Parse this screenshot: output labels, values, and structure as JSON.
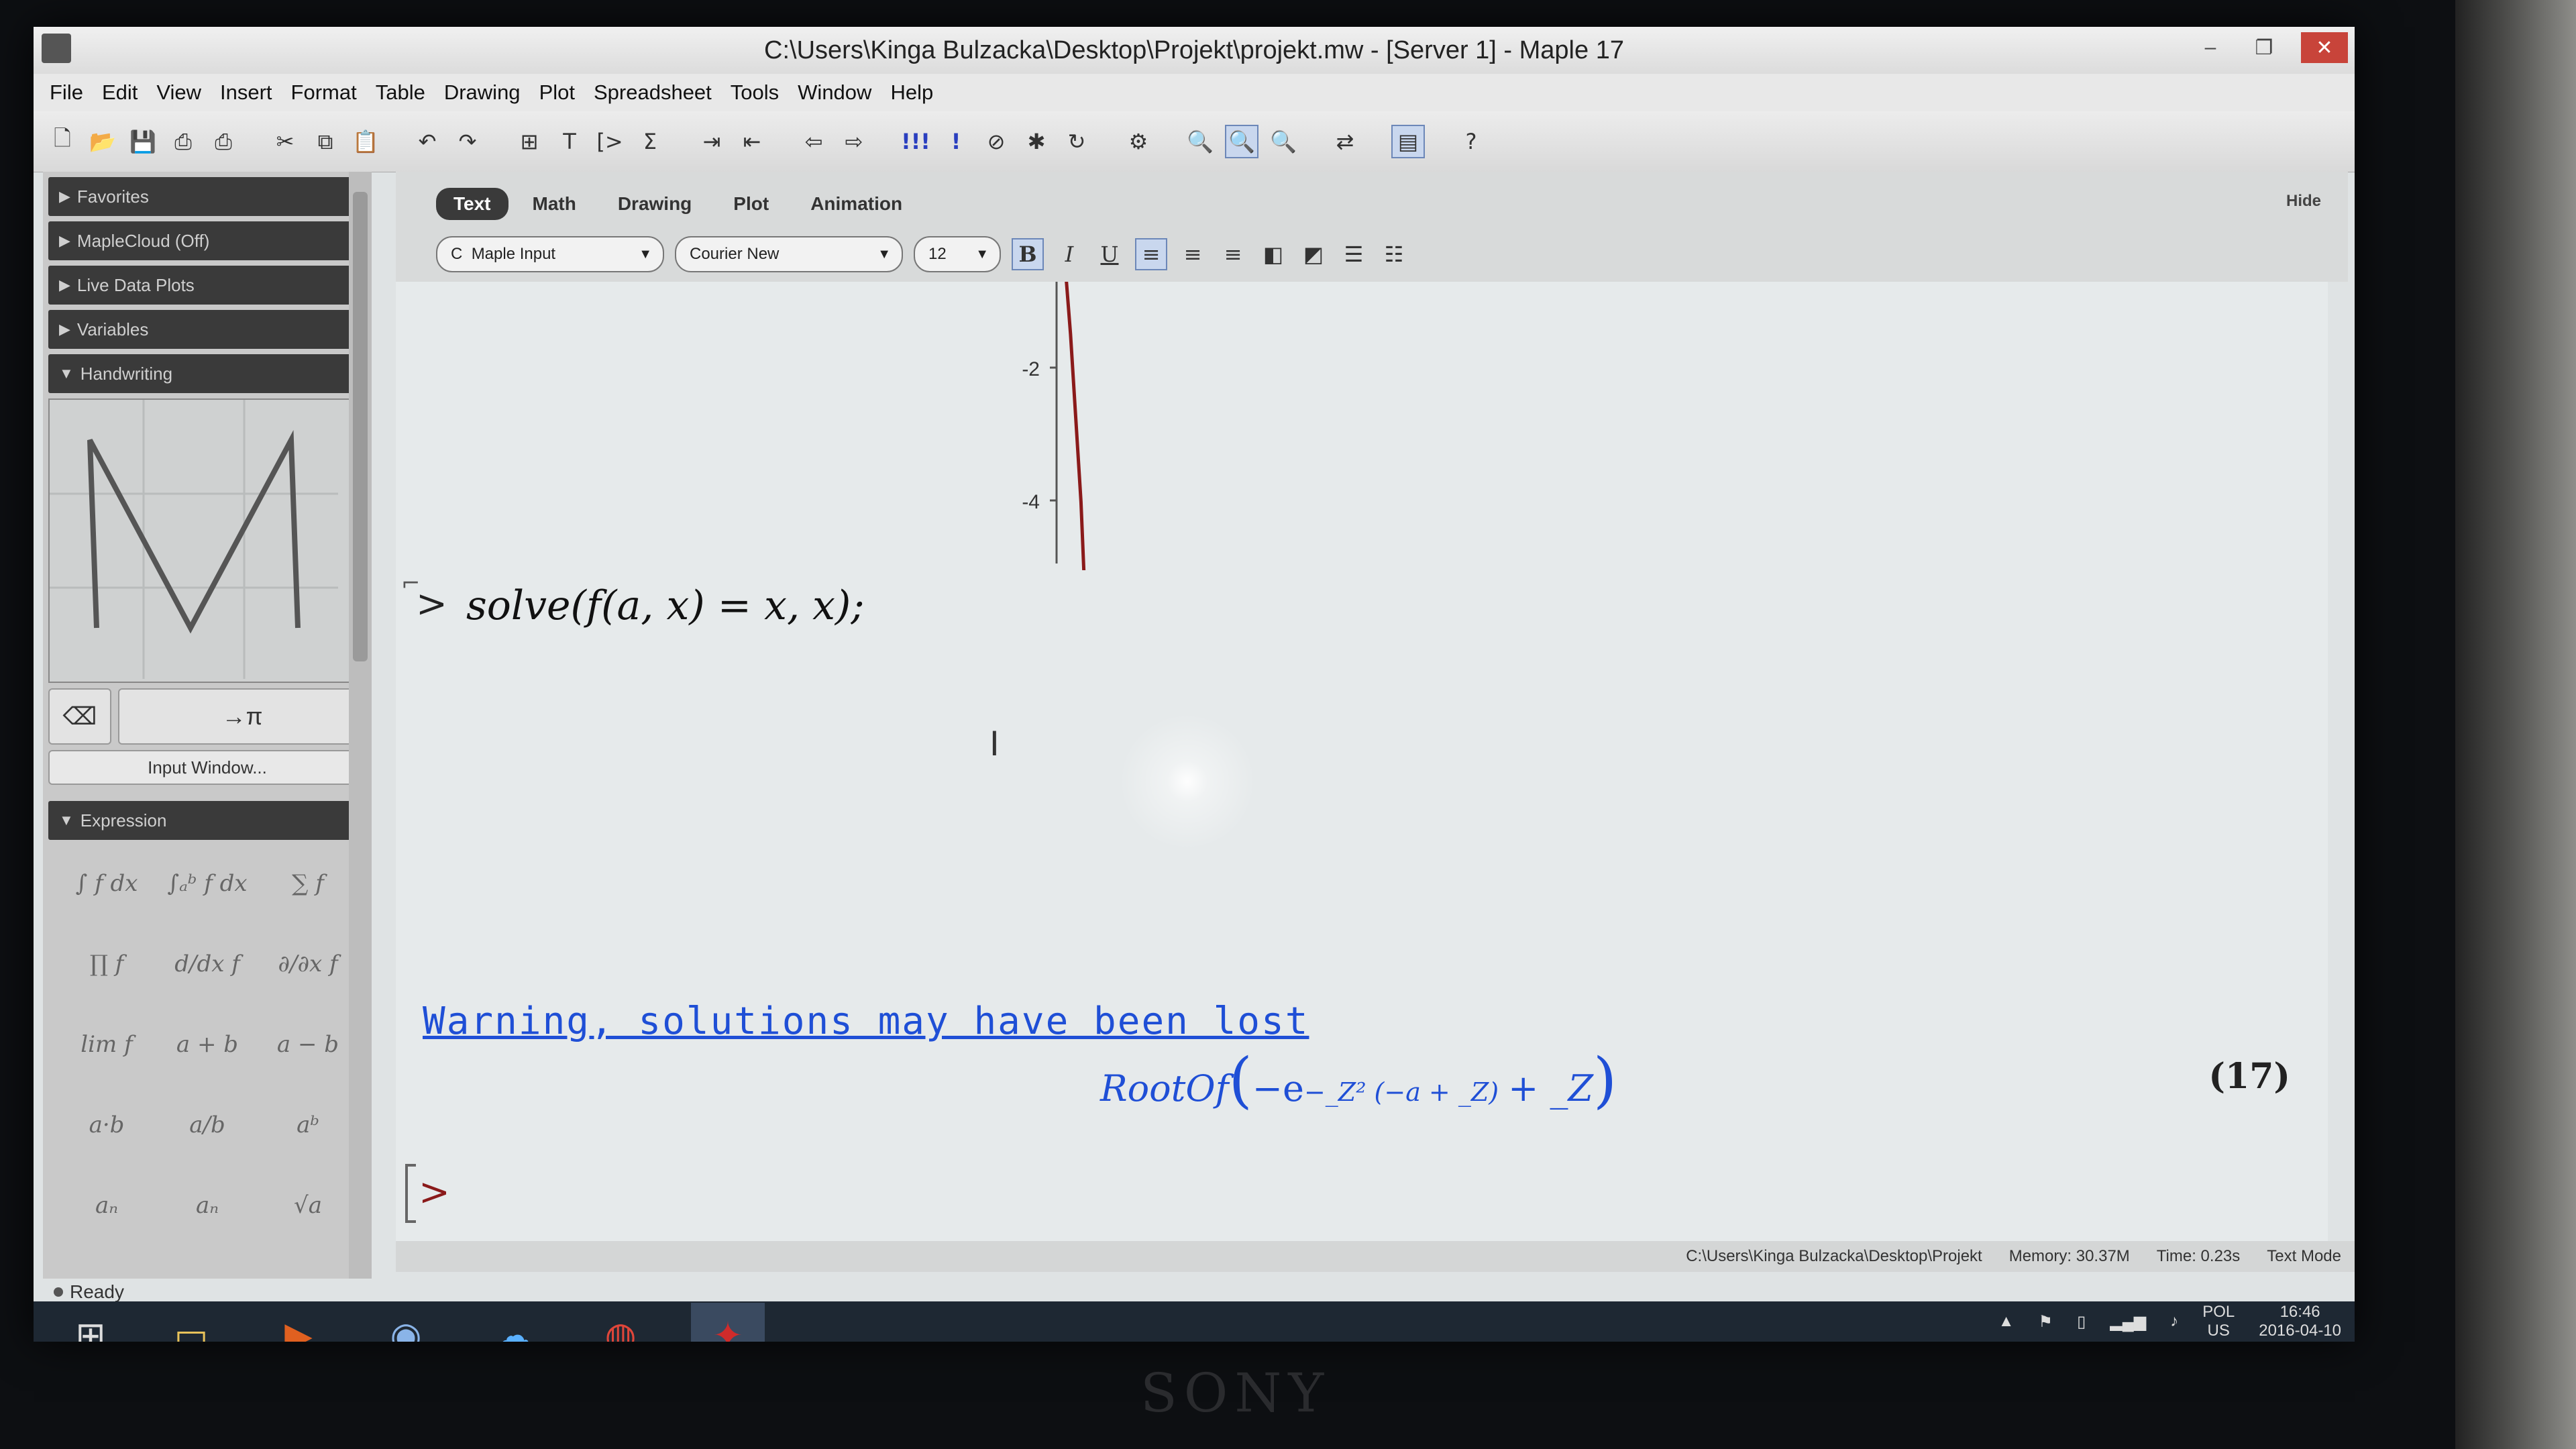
{
  "window": {
    "title": "C:\\Users\\Kinga Bulzacka\\Desktop\\Projekt\\projekt.mw - [Server 1] - Maple 17"
  },
  "menu": [
    "File",
    "Edit",
    "View",
    "Insert",
    "Format",
    "Table",
    "Drawing",
    "Plot",
    "Spreadsheet",
    "Tools",
    "Window",
    "Help"
  ],
  "palette": {
    "sections": [
      {
        "label": "Favorites",
        "collapsed": true
      },
      {
        "label": "MapleCloud (Off)",
        "collapsed": true
      },
      {
        "label": "Live Data Plots",
        "collapsed": true
      },
      {
        "label": "Variables",
        "collapsed": true
      }
    ],
    "handwriting": {
      "label": "Handwriting",
      "recognize_symbol": "π",
      "input_window_label": "Input Window..."
    },
    "expression": {
      "label": "Expression",
      "cells": [
        "∫ f dx",
        "∫ₐᵇ f dx",
        "∑ f",
        "∏ f",
        "d/dx f",
        "∂/∂x f",
        "lim f",
        "a + b",
        "a − b",
        "a·b",
        "a/b",
        "aᵇ",
        "aₙ",
        "aₙ",
        "√a"
      ]
    }
  },
  "context_tabs": [
    "Text",
    "Math",
    "Drawing",
    "Plot",
    "Animation"
  ],
  "active_tab": "Text",
  "hide_label": "Hide",
  "format": {
    "style": "Maple Input",
    "style_prefix": "C",
    "font": "Courier New",
    "size": "12"
  },
  "plot": {
    "y_ticks": [
      "-2",
      "-4"
    ],
    "curve": [
      [
        0.02,
        -0.1
      ],
      [
        0.05,
        -0.8
      ],
      [
        0.08,
        -1.6
      ],
      [
        0.11,
        -2.6
      ],
      [
        0.14,
        -3.6
      ],
      [
        0.16,
        -4.6
      ],
      [
        0.17,
        -5.0
      ]
    ]
  },
  "worksheet": {
    "prompt": ">",
    "command": "solve(f(a, x) = x, x);",
    "warning": "Warning, solutions may have been lost",
    "result": {
      "name": "RootOf",
      "body_pre": "−e",
      "exponent": "−_Z² (−a + _Z)",
      "body_post": "+ _Z"
    },
    "equation_label": "(17)",
    "next_prompt": ">"
  },
  "status_bar": {
    "path": "C:\\Users\\Kinga Bulzacka\\Desktop\\Projekt",
    "memory": "Memory: 30.37M",
    "time": "Time: 0.23s",
    "mode": "Text Mode",
    "ready": "Ready"
  },
  "tray": {
    "lang_top": "POL",
    "lang_bottom": "US",
    "time": "16:46",
    "date": "2016-04-10"
  },
  "bezel_brand": "SONY",
  "colors": {
    "output_blue": "#1f4fd6",
    "palette_header": "#3a3a3a"
  }
}
